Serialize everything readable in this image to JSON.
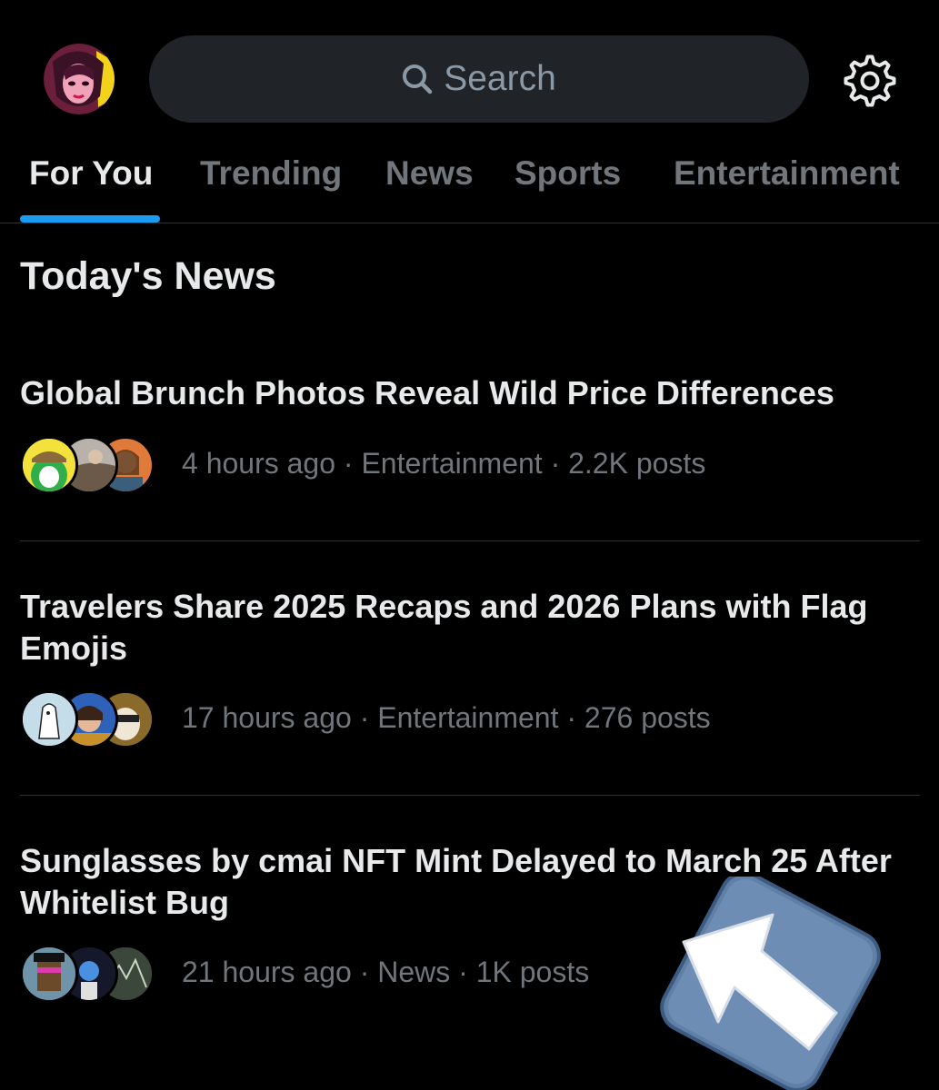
{
  "header": {
    "search_placeholder": "Search",
    "icons": [
      "avatar",
      "search-icon",
      "gear-icon"
    ]
  },
  "tabs": [
    {
      "label": "For You",
      "active": true
    },
    {
      "label": "Trending",
      "active": false
    },
    {
      "label": "News",
      "active": false
    },
    {
      "label": "Sports",
      "active": false
    },
    {
      "label": "Entertainment",
      "active": false
    }
  ],
  "section_title": "Today's News",
  "stories": [
    {
      "headline": "Global Brunch Photos Reveal Wild Price Differences",
      "meta": "4 hours ago · Entertainment · 2.2K posts"
    },
    {
      "headline": "Travelers Share 2025 Recaps and 2026 Plans with Flag Emojis",
      "meta": "17 hours ago · Entertainment · 276 posts"
    },
    {
      "headline": "Sunglasses by cmai NFT Mint Delayed to March 25 After Whitelist Bug",
      "meta": "21 hours ago · News · 1K posts"
    }
  ],
  "colors": {
    "background": "#000000",
    "accent": "#1d9bf0",
    "muted_text": "#71767b",
    "search_bg": "#202327"
  }
}
